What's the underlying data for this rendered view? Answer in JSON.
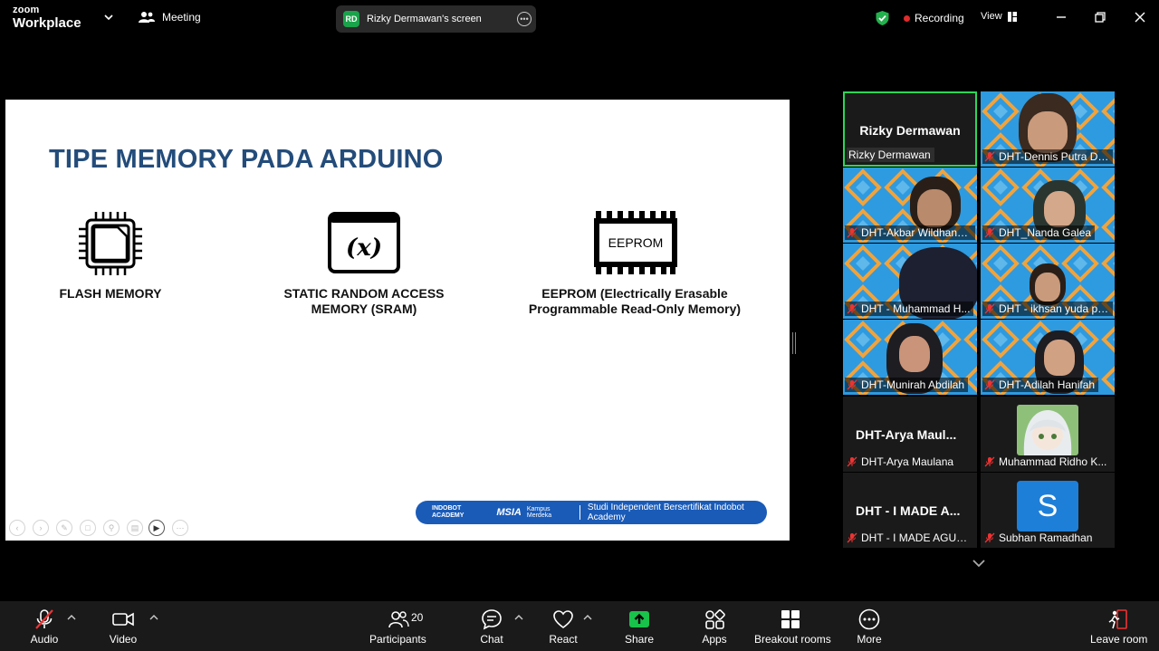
{
  "app": {
    "logo_line1": "zoom",
    "logo_line2": "Workplace",
    "meeting_label": "Meeting",
    "screen_share_initials": "RD",
    "screen_share_label": "Rizky Dermawan's screen",
    "recording_label": "Recording",
    "view_label": "View"
  },
  "slide": {
    "title": "TIPE MEMORY PADA ARDUINO",
    "items": [
      {
        "label": "FLASH MEMORY",
        "icon": "chip-icon"
      },
      {
        "label": "STATIC RANDOM ACCESS MEMORY (SRAM)",
        "icon": "variable-icon"
      },
      {
        "label": "EEPROM (Electrically Erasable Programmable Read-Only Memory)",
        "icon": "eeprom-icon"
      }
    ],
    "eeprom_chip_text": "EEPROM",
    "variable_glyph": "(x)",
    "banner": {
      "brand": "INDOBOT ACADEMY",
      "msia": "MSIA",
      "km": "Kampus Merdeka",
      "text": "Studi Independent Bersertifikat Indobot Academy"
    }
  },
  "gallery": {
    "tiles": [
      {
        "name": "Rizky Dermawan",
        "big_name": "Rizky Dermawan",
        "active": true
      },
      {
        "name": "DHT-Dennis Putra Dw..."
      },
      {
        "name": "DHT-Akbar Wildhanata"
      },
      {
        "name": "DHT_Nanda Galea"
      },
      {
        "name": "DHT - Muhammad H..."
      },
      {
        "name": "DHT - ikhsan yuda pr..."
      },
      {
        "name": "DHT-Munirah Abdilah"
      },
      {
        "name": "DHT-Adilah Hanifah"
      },
      {
        "name": "DHT-Arya Maulana",
        "big_name": "DHT-Arya  Maul..."
      },
      {
        "name": "Muhammad Ridho K..."
      },
      {
        "name": "DHT - I MADE AGUS ...",
        "big_name": "DHT - I MADE A..."
      },
      {
        "name": "Subhan Ramadhan",
        "avatar_letter": "S"
      }
    ]
  },
  "toolbar": {
    "audio": "Audio",
    "video": "Video",
    "participants": "Participants",
    "participants_count": "20",
    "chat": "Chat",
    "react": "React",
    "share": "Share",
    "apps": "Apps",
    "breakout": "Breakout rooms",
    "more": "More",
    "leave": "Leave room"
  },
  "colors": {
    "slide_title": "#234c7a",
    "active_border": "#2bd659",
    "share_green": "#19c24a",
    "tile_blue": "#2e9ae0",
    "recording_dot": "#e02b2b"
  }
}
